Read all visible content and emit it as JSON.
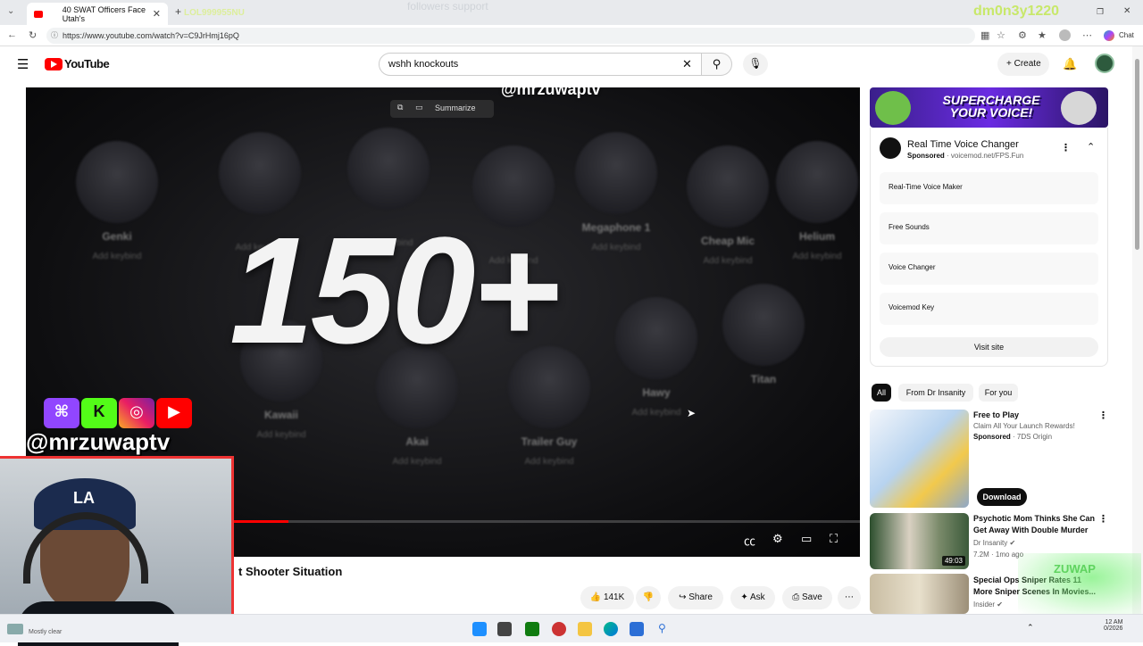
{
  "browser": {
    "tab_title": "40 SWAT Officers Face Utah's",
    "url": "https://www.youtube.com/watch?v=C9JrHmj16pQ",
    "overlay_text_1": "LOL999955NU",
    "overlay_text_2": "followers support",
    "overlay_text_3": "dm0n3y1220",
    "chat_label": "Chat"
  },
  "youtube": {
    "logo_text": "YouTube",
    "search_value": "wshh knockouts",
    "create_label": "Create"
  },
  "player": {
    "big_text": "150+",
    "watermark": "@mrzuwaptv",
    "summarize_label": "Summarize",
    "handle": "@mrzuwaptv",
    "progress_fraction": 0.315,
    "social_icons": [
      "twitch-icon",
      "kick-icon",
      "instagram-icon",
      "youtube-icon"
    ],
    "voice_items": [
      {
        "name": "Genki",
        "sub": "Add keybind"
      },
      {
        "name": "",
        "sub": "Add keybind"
      },
      {
        "name": "",
        "sub": "Add keybind"
      },
      {
        "name": "",
        "sub": "Add keybind"
      },
      {
        "name": "Megaphone 1",
        "sub": "Add keybind"
      },
      {
        "name": "Cheap Mic",
        "sub": "Add keybind"
      },
      {
        "name": "Helium",
        "sub": "Add keybind"
      },
      {
        "name": "Kawaii",
        "sub": "Add keybind"
      },
      {
        "name": "Akai",
        "sub": "Add keybind"
      },
      {
        "name": "Trailer Guy",
        "sub": "Add keybind"
      },
      {
        "name": "Hawy",
        "sub": "Add keybind"
      },
      {
        "name": "Titan",
        "sub": ""
      }
    ]
  },
  "video": {
    "title": "t Shooter Situation",
    "likes": "141K",
    "share_label": "Share",
    "ask_label": "Ask",
    "save_label": "Save"
  },
  "ad": {
    "banner_text": "SUPERCHARGE YOUR VOICE!",
    "title": "Real Time Voice Changer",
    "sponsored": "Sponsored",
    "domain": "voicemod.net/FPS.Fun",
    "links": [
      "Real-Time Voice Maker",
      "Free Sounds",
      "Voice Changer",
      "Voicemod Key"
    ],
    "visit_label": "Visit site"
  },
  "chips": [
    "All",
    "From Dr Insanity",
    "For you"
  ],
  "recommendations": [
    {
      "title": "Free to Play",
      "line2": "Claim All Your Launch Rewards!",
      "sponsored": "Sponsored",
      "channel": "7DS Origin",
      "button": "Download"
    },
    {
      "title": "Psychotic Mom Thinks She Can Get Away With Double Murder",
      "channel": "Dr Insanity",
      "meta": "7.2M",
      "meta2": "1mo ago",
      "duration": "49:03"
    },
    {
      "title": "Special Ops Sniper Rates 11 More Sniper Scenes In Movies...",
      "channel": "Insider"
    }
  ],
  "webcam": {
    "cap_text": "LA",
    "corner_watermark": "ZUWAP"
  },
  "taskbar": {
    "weather": "Mostly clear",
    "time": "12 AM",
    "date": "0/2026"
  }
}
